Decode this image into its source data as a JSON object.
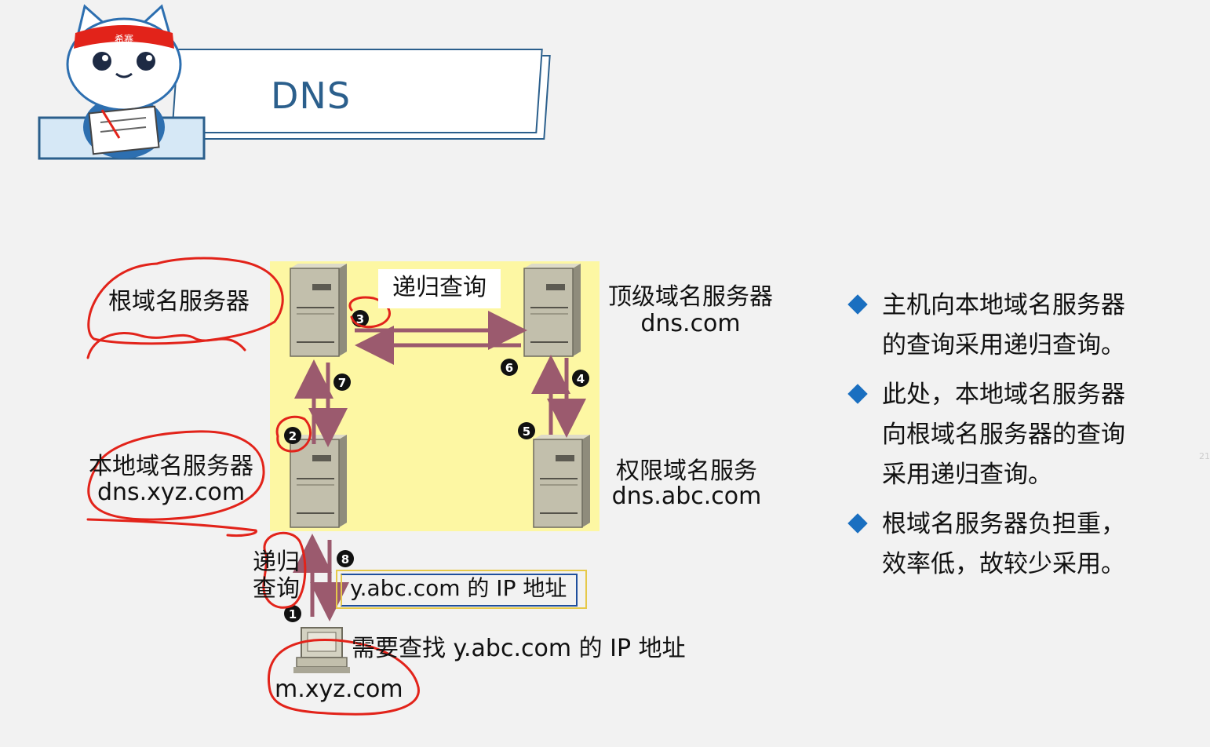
{
  "slide": {
    "title": "DNS",
    "mascot_band_text": "希赛"
  },
  "diagram": {
    "root_server_label": "根域名服务器",
    "tld_server_label": "顶级域名服务器",
    "tld_server_domain": "dns.com",
    "local_server_label": "本地域名服务器",
    "local_server_domain": "dns.xyz.com",
    "auth_server_label": "权限域名服务",
    "auth_server_domain": "dns.abc.com",
    "recursive_query_box": "递归查询",
    "host_query_line1": "递归",
    "host_query_line2": "查询",
    "ip_answer_box": "y.abc.com 的 IP 地址",
    "host_need": "需要查找 y.abc.com 的 IP 地址",
    "host_domain": "m.xyz.com",
    "steps": [
      "1",
      "2",
      "3",
      "4",
      "5",
      "6",
      "7",
      "8"
    ]
  },
  "bullets": [
    {
      "line1": "主机向本地域名服务器",
      "line2": "的查询采用递归查询。"
    },
    {
      "line1": "此处，本地域名服务器",
      "line2": "向根域名服务器的查询",
      "line3": "采用递归查询。"
    },
    {
      "line1": "根域名服务器负担重，",
      "line2": "效率低，故较少采用。"
    }
  ],
  "page_marker": "21",
  "colors": {
    "title": "#2b5f8c",
    "highlight_area": "#fdf7a3",
    "arrow": "#9b5a6e",
    "bullet_diamond": "#1a6fc0",
    "annotation": "#e2231a"
  }
}
